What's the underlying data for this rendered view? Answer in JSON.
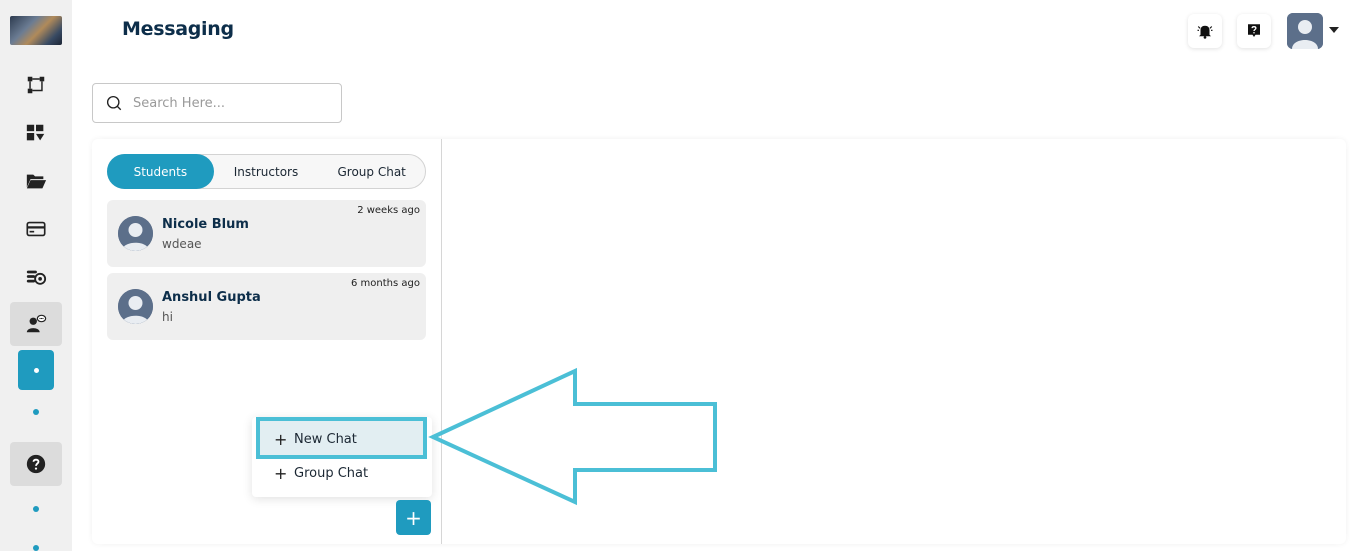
{
  "app": {
    "page_title": "Messaging"
  },
  "search": {
    "placeholder": "Search Here..."
  },
  "tabs": [
    {
      "label": "Students",
      "active": true
    },
    {
      "label": "Instructors",
      "active": false
    },
    {
      "label": "Group Chat",
      "active": false
    }
  ],
  "chats": [
    {
      "name": "Nicole Blum",
      "preview": "wdeae",
      "time": "2 weeks ago"
    },
    {
      "name": "Anshul Gupta",
      "preview": "hi",
      "time": "6 months ago"
    }
  ],
  "new_menu": {
    "items": [
      {
        "label": "New Chat",
        "highlighted": true
      },
      {
        "label": "Group Chat",
        "highlighted": false
      }
    ]
  },
  "fab": {
    "label": "+"
  },
  "colors": {
    "accent": "#1f9bbf",
    "annotation": "#4bbfd6"
  }
}
